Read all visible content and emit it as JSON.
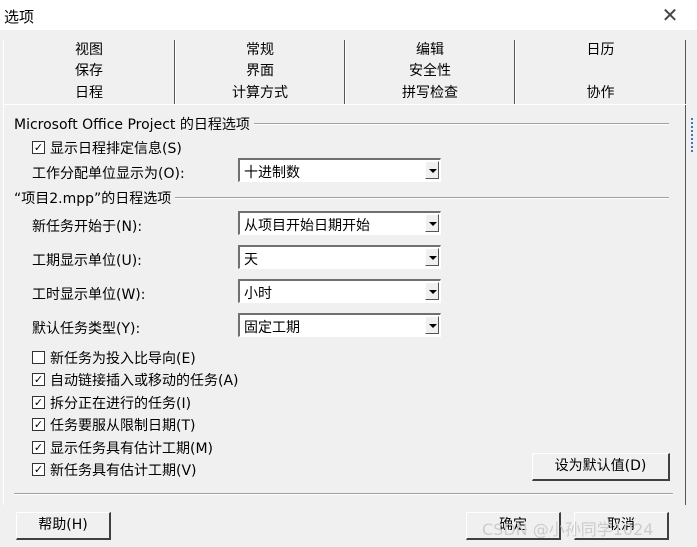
{
  "window": {
    "title": "选项",
    "close_glyph": "✕"
  },
  "tabs": {
    "row1": [
      "视图",
      "常规",
      "编辑",
      "日历"
    ],
    "row2": [
      "保存",
      "界面",
      "安全性",
      ""
    ],
    "row3": [
      "日程",
      "计算方式",
      "拼写检查",
      "协作"
    ]
  },
  "schedule_group": {
    "title": "Microsoft Office Project 的日程选项",
    "show_messages": {
      "label": "显示日程排定信息(S)",
      "checked": true
    },
    "assignment_units": {
      "label": "工作分配单位显示为(O):",
      "value": "十进制数"
    }
  },
  "project_group": {
    "title": "“项目2.mpp”的日程选项",
    "fields": [
      {
        "label": "新任务开始于(N):",
        "value": "从项目开始日期开始"
      },
      {
        "label": "工期显示单位(U):",
        "value": "天"
      },
      {
        "label": "工时显示单位(W):",
        "value": "小时"
      },
      {
        "label": "默认任务类型(Y):",
        "value": "固定工期"
      }
    ],
    "checkboxes": [
      {
        "label": "新任务为投入比导向(E)",
        "checked": false
      },
      {
        "label": "自动链接插入或移动的任务(A)",
        "checked": true
      },
      {
        "label": "拆分正在进行的任务(I)",
        "checked": true
      },
      {
        "label": "任务要服从限制日期(T)",
        "checked": true
      },
      {
        "label": "显示任务具有估计工期(M)",
        "checked": true
      },
      {
        "label": "新任务具有估计工期(V)",
        "checked": true
      }
    ],
    "set_default_label": "设为默认值(D)"
  },
  "footer": {
    "help_label": "帮助(H)",
    "ok_label": "确定",
    "cancel_label": "取消"
  },
  "watermark": "CSDN @小孙同学1024"
}
